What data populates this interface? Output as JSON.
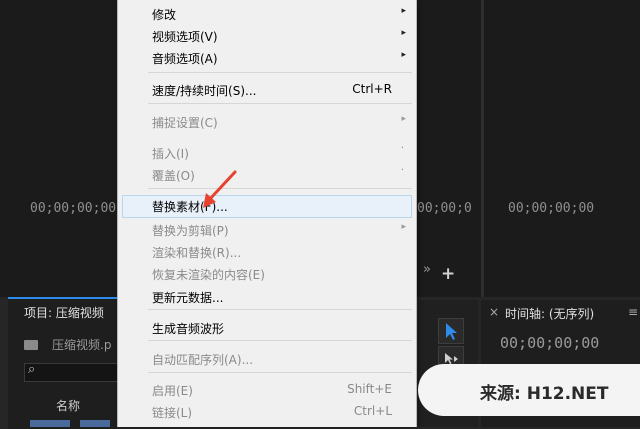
{
  "monitors": {
    "left_timecode": "00;00;00;00",
    "mid_timecode": "00;00;0",
    "right_timecode": "00;00;00;00",
    "forward_glyph": "»",
    "add_glyph": "+"
  },
  "project_panel": {
    "title": "项目: 压缩视频",
    "subtitle": "压缩视频.p",
    "column_name": "名称",
    "search_icon_glyph": "⌕"
  },
  "timeline_panel": {
    "close_glyph": "×",
    "title": "时间轴: (无序列)",
    "menu_glyph": "≡",
    "timecode": "00;00;00;00"
  },
  "context_menu": {
    "items": [
      {
        "label": "修改",
        "shortcut": "",
        "submenu": true,
        "enabled": true
      },
      {
        "label": "视频选项(V)",
        "shortcut": "",
        "submenu": true,
        "enabled": true
      },
      {
        "label": "音频选项(A)",
        "shortcut": "",
        "submenu": true,
        "enabled": true
      },
      {
        "label": "速度/持续时间(S)...",
        "shortcut": "Ctrl+R",
        "submenu": false,
        "enabled": true
      },
      {
        "label": "捕捉设置(C)",
        "shortcut": "",
        "submenu": true,
        "enabled": false
      },
      {
        "label": "插入(I)",
        "shortcut": "",
        "submenu": false,
        "enabled": false
      },
      {
        "label": "覆盖(O)",
        "shortcut": "",
        "submenu": false,
        "enabled": false
      },
      {
        "label": "替换素材(F)...",
        "shortcut": "",
        "submenu": false,
        "enabled": true
      },
      {
        "label": "替换为剪辑(P)",
        "shortcut": "",
        "submenu": true,
        "enabled": false
      },
      {
        "label": "渲染和替换(R)...",
        "shortcut": "",
        "submenu": false,
        "enabled": false
      },
      {
        "label": "恢复未渲染的内容(E)",
        "shortcut": "",
        "submenu": false,
        "enabled": false
      },
      {
        "label": "更新元数据...",
        "shortcut": "",
        "submenu": false,
        "enabled": true
      },
      {
        "label": "生成音频波形",
        "shortcut": "",
        "submenu": false,
        "enabled": true
      },
      {
        "label": "自动匹配序列(A)...",
        "shortcut": "",
        "submenu": false,
        "enabled": false
      },
      {
        "label": "启用(E)",
        "shortcut": "Shift+E",
        "submenu": false,
        "enabled": false
      },
      {
        "label": "链接(L)",
        "shortcut": "Ctrl+L",
        "submenu": false,
        "enabled": false
      }
    ],
    "submenu_arrow": "▸",
    "dot_glyph": "·"
  },
  "watermark": {
    "text": "来源: H12.NET"
  },
  "colors": {
    "accent_blue": "#2d8ceb",
    "arrow_red": "#e8412f"
  }
}
